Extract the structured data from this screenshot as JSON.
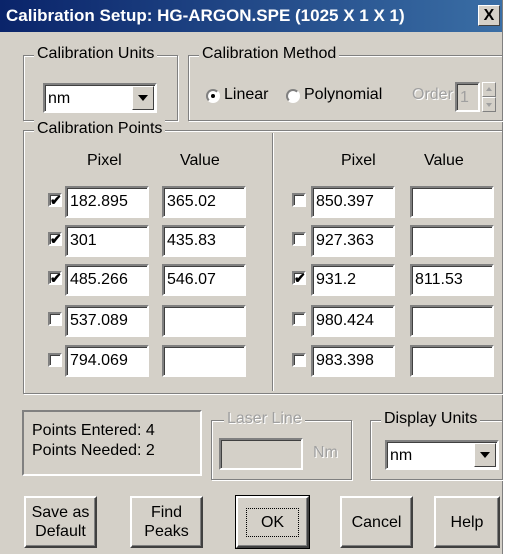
{
  "window": {
    "title": "Calibration Setup: HG-ARGON.SPE (1025 X 1 X 1)",
    "close_glyph": "X"
  },
  "calibration_units": {
    "label": "Calibration Units",
    "value": "nm"
  },
  "calibration_method": {
    "label": "Calibration Method",
    "linear_label": "Linear",
    "polynomial_label": "Polynomial",
    "selected": "Linear",
    "order_label": "Order",
    "order_value": "1"
  },
  "calibration_points": {
    "label": "Calibration Points",
    "pixel_header": "Pixel",
    "value_header": "Value",
    "left": [
      {
        "checked": true,
        "check_glyph": "✔",
        "pixel": "182.895",
        "value": "365.02"
      },
      {
        "checked": true,
        "check_glyph": "✔",
        "pixel": "301",
        "value": "435.83"
      },
      {
        "checked": true,
        "check_glyph": "✔",
        "pixel": "485.266",
        "value": "546.07"
      },
      {
        "checked": false,
        "check_glyph": "",
        "pixel": "537.089",
        "value": ""
      },
      {
        "checked": false,
        "check_glyph": "",
        "pixel": "794.069",
        "value": ""
      }
    ],
    "right": [
      {
        "checked": false,
        "check_glyph": "",
        "pixel": "850.397",
        "value": ""
      },
      {
        "checked": false,
        "check_glyph": "",
        "pixel": "927.363",
        "value": ""
      },
      {
        "checked": true,
        "check_glyph": "✔",
        "pixel": "931.2",
        "value": "811.53"
      },
      {
        "checked": false,
        "check_glyph": "",
        "pixel": "980.424",
        "value": ""
      },
      {
        "checked": false,
        "check_glyph": "",
        "pixel": "983.398",
        "value": ""
      }
    ]
  },
  "status": {
    "points_entered_label": "Points Entered:",
    "points_entered": "4",
    "points_needed_label": "Points Needed:",
    "points_needed": "2"
  },
  "laser_line": {
    "label": "Laser Line",
    "value": "",
    "unit": "Nm"
  },
  "display_units": {
    "label": "Display Units",
    "value": "nm"
  },
  "buttons": {
    "save_default_line1": "Save as",
    "save_default_line2": "Default",
    "find_peaks_line1": "Find",
    "find_peaks_line2": "Peaks",
    "ok": "OK",
    "cancel": "Cancel",
    "help": "Help"
  }
}
